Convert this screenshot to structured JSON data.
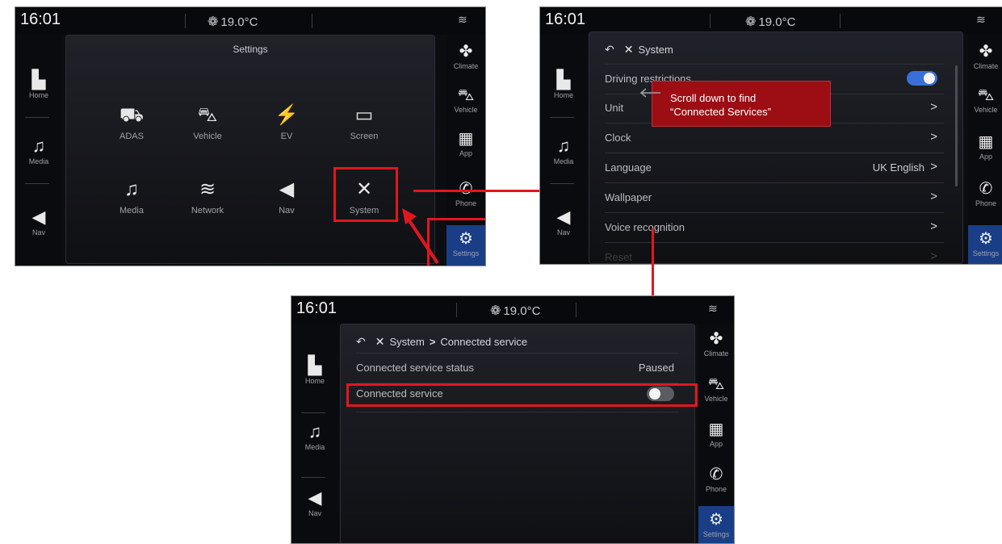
{
  "status": {
    "time": "16:01",
    "temperature": "19.0°C",
    "fan_icon": "fan-icon"
  },
  "left_nav": [
    {
      "label": "Home",
      "icon": "home-icon"
    },
    {
      "label": "Media",
      "icon": "music-note-icon"
    },
    {
      "label": "Nav",
      "icon": "navigation-arrow-icon"
    }
  ],
  "right_nav": [
    {
      "label": "Climate",
      "icon": "fan-icon"
    },
    {
      "label": "Vehicle",
      "icon": "car-icon"
    },
    {
      "label": "App",
      "icon": "grid-icon"
    },
    {
      "label": "Phone",
      "icon": "phone-icon"
    },
    {
      "label": "Settings",
      "icon": "gear-icon"
    }
  ],
  "settings_screen": {
    "title": "Settings",
    "tiles": [
      {
        "label": "ADAS",
        "icon": "adas-icon"
      },
      {
        "label": "Vehicle",
        "icon": "vehicle-settings-icon"
      },
      {
        "label": "EV",
        "icon": "ev-icon"
      },
      {
        "label": "Screen",
        "icon": "screen-icon"
      },
      {
        "label": "Media",
        "icon": "media-settings-icon"
      },
      {
        "label": "Network",
        "icon": "network-icon"
      },
      {
        "label": "Nav",
        "icon": "nav-settings-icon"
      },
      {
        "label": "System",
        "icon": "system-tools-icon"
      }
    ]
  },
  "system_screen": {
    "title": "System",
    "rows": [
      {
        "label": "Driving restrictions",
        "toggle": "on"
      },
      {
        "label": "Unit",
        "chevron": ">"
      },
      {
        "label": "Clock",
        "chevron": ">"
      },
      {
        "label": "Language",
        "value": "UK English",
        "chevron": ">"
      },
      {
        "label": "Wallpaper",
        "chevron": ">"
      },
      {
        "label": "Voice recognition",
        "chevron": ">"
      },
      {
        "label": "Reset",
        "chevron": ">"
      }
    ]
  },
  "callout": {
    "line1": "Scroll down to find",
    "line2": "“Connected Services”"
  },
  "connected_screen": {
    "breadcrumb_root": "System",
    "breadcrumb_separator": ">",
    "breadcrumb_current": "Connected service",
    "rows": [
      {
        "label": "Connected service status",
        "value": "Paused"
      },
      {
        "label": "Connected service",
        "toggle": "off"
      }
    ]
  },
  "colors": {
    "highlight": "#e2161f",
    "callout_bg": "#9c0e14",
    "toggle_on": "#3a6fd8",
    "active_nav": "#1a3e86"
  }
}
